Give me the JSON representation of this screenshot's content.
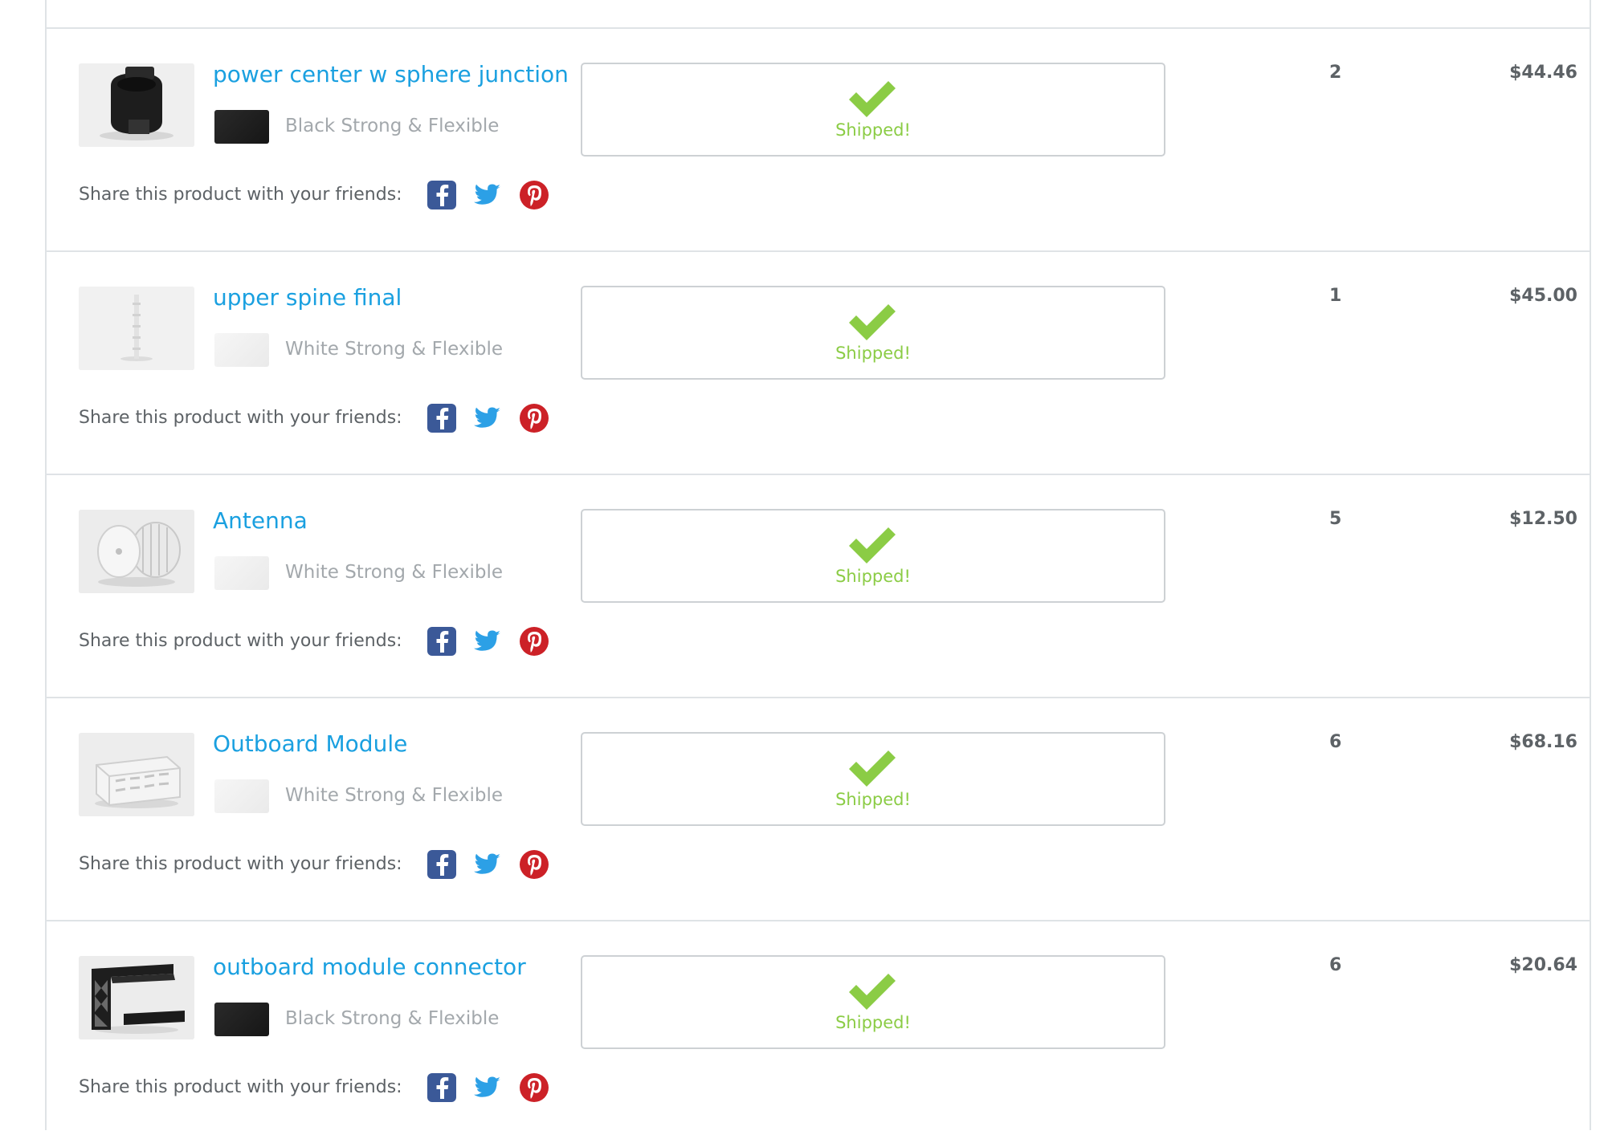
{
  "share_label": "Share this product with your friends:",
  "status_label": "Shipped!",
  "colors": {
    "link": "#1aa0e0",
    "shipped": "#8bcc45",
    "text": "#5d6266",
    "muted": "#a3a8ac",
    "facebook": "#3b5998",
    "twitter": "#2ca0e6",
    "pinterest": "#cc2127"
  },
  "items": [
    {
      "name": "power center w sphere junction",
      "material": "Black Strong & Flexible",
      "swatch": "black",
      "quantity": "2",
      "price": "$44.46",
      "thumb": "power-center-render"
    },
    {
      "name": "upper spine final",
      "material": "White Strong & Flexible",
      "swatch": "white",
      "quantity": "1",
      "price": "$45.00",
      "thumb": "upper-spine-render"
    },
    {
      "name": "Antenna",
      "material": "White Strong & Flexible",
      "swatch": "white",
      "quantity": "5",
      "price": "$12.50",
      "thumb": "antenna-render"
    },
    {
      "name": "Outboard Module",
      "material": "White Strong & Flexible",
      "swatch": "white",
      "quantity": "6",
      "price": "$68.16",
      "thumb": "outboard-module-render"
    },
    {
      "name": "outboard module connector",
      "material": "Black Strong & Flexible",
      "swatch": "black",
      "quantity": "6",
      "price": "$20.64",
      "thumb": "outboard-connector-render"
    }
  ]
}
